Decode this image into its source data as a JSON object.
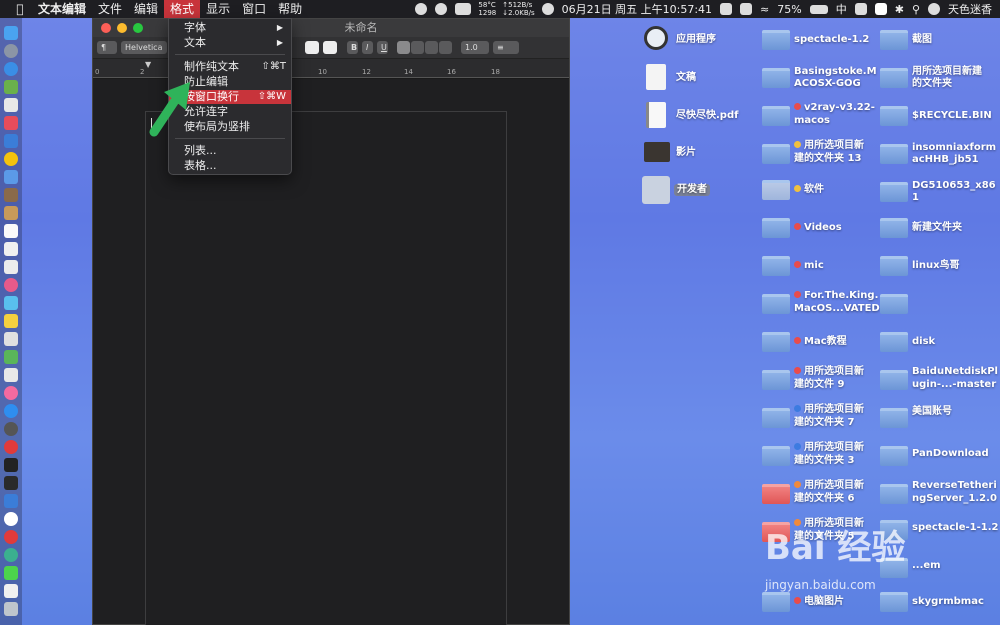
{
  "menubar": {
    "app_name": "文本编辑",
    "items": [
      "文件",
      "编辑",
      "格式",
      "显示",
      "窗口",
      "帮助"
    ],
    "active_item": "格式",
    "status": {
      "temp": "58°C",
      "fan": "1298",
      "net_up": "↑512B/s",
      "net_down": "↓2.0KB/s",
      "datetime": "06月21日 周五 上午10:57:41",
      "battery": "75%",
      "input": "中",
      "user": "天色迷香"
    }
  },
  "window": {
    "title": "未命名",
    "font_name": "Helvetica",
    "line_spacing": "1.0",
    "ruler_ticks": [
      "0",
      "2",
      "4",
      "6",
      "8",
      "10",
      "12",
      "14",
      "16",
      "18"
    ]
  },
  "format_menu": {
    "font": "字体",
    "text": "文本",
    "make_plain": "制作纯文本",
    "make_plain_shortcut": "⇧⌘T",
    "prevent_edit": "防止编辑",
    "wrap_window": "按窗口换行",
    "wrap_window_shortcut": "⇧⌘W",
    "ligature": "允许连字",
    "vertical": "使布局为竖排",
    "list": "列表...",
    "table": "表格..."
  },
  "desktop": {
    "col1": [
      {
        "label": "应用程序"
      },
      {
        "label": "文稿"
      },
      {
        "label": "尽快尽快.pdf"
      },
      {
        "label": "影片"
      },
      {
        "label": "开发者"
      }
    ],
    "col2": [
      {
        "l1": "spectacle-1.2",
        "l2": ""
      },
      {
        "l1": "Basingstoke.M",
        "l2": "ACOSX-GOG"
      },
      {
        "l1": "v2ray-v3.22-",
        "l2": "macos"
      },
      {
        "l1": "用所选项目新",
        "l2": "建的文件夹 13"
      },
      {
        "l1": "软件",
        "l2": ""
      },
      {
        "l1": "Videos",
        "l2": ""
      },
      {
        "l1": "mic",
        "l2": ""
      },
      {
        "l1": "For.The.King.",
        "l2": "MacOS...VATED"
      },
      {
        "l1": "Mac教程",
        "l2": ""
      },
      {
        "l1": "用所选项目新",
        "l2": "建的文件 9"
      },
      {
        "l1": "用所选项目新",
        "l2": "建的文件夹 7"
      },
      {
        "l1": "用所选项目新",
        "l2": "建的文件夹 3"
      },
      {
        "l1": "用所选项目新",
        "l2": "建的文件夹 6"
      },
      {
        "l1": "用所选项目新",
        "l2": "建的文件夹 5"
      },
      {
        "l1": "",
        "l2": ""
      },
      {
        "l1": "电脑图片",
        "l2": ""
      }
    ],
    "col3": [
      {
        "l1": "截图",
        "l2": ""
      },
      {
        "l1": "用所选项目新建",
        "l2": "的文件夹"
      },
      {
        "l1": "$RECYCLE.BIN",
        "l2": ""
      },
      {
        "l1": "insomniaxform",
        "l2": "acHHB_jb51"
      },
      {
        "l1": "DG510653_x86",
        "l2": "1"
      },
      {
        "l1": "新建文件夹",
        "l2": ""
      },
      {
        "l1": "linux鸟哥",
        "l2": ""
      },
      {
        "l1": "",
        "l2": ""
      },
      {
        "l1": "disk",
        "l2": ""
      },
      {
        "l1": "BaiduNetdiskPl",
        "l2": "ugin-...-master"
      },
      {
        "l1": "美国账号",
        "l2": ""
      },
      {
        "l1": "PanDownload",
        "l2": ""
      },
      {
        "l1": "ReverseTetheri",
        "l2": "ngServer_1.2.0"
      },
      {
        "l1": "spectacle-1-1.2",
        "l2": ""
      },
      {
        "l1": "...em",
        "l2": ""
      },
      {
        "l1": "skygrmbmac",
        "l2": ""
      }
    ]
  },
  "watermark": {
    "brand": "Bai 经验",
    "url": "jingyan.baidu.com"
  },
  "colors": {
    "accent": "#c8343b",
    "menubar": "#1e1e22",
    "folder": "#7aa2e0"
  }
}
